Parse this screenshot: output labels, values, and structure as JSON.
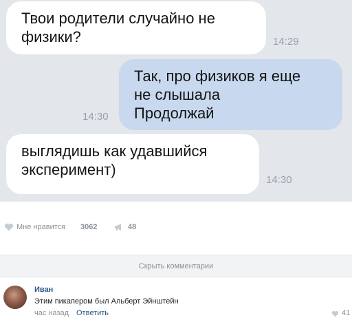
{
  "chat": {
    "messages": [
      {
        "side": "in",
        "text": "Твои родители случайно не\nфизики?",
        "time": "14:29"
      },
      {
        "side": "out",
        "text": "Так, про физиков я еще\nне слышала\nПродолжай",
        "time": "14:30"
      },
      {
        "side": "in",
        "text": "выглядишь как удавшийся\nэксперимент)",
        "time": "14:30"
      }
    ]
  },
  "post": {
    "like_label": "Мне нравится",
    "like_count": "3062",
    "share_count": "48",
    "hide_comments_label": "Скрыть комментарии"
  },
  "comment": {
    "author": "Иван",
    "text": "Этим пикапером был Альберт Эйнштейн",
    "time": "час назад",
    "reply_label": "Ответить",
    "like_count": "41"
  },
  "colors": {
    "chat_background": "#e3e6ea",
    "incoming_bubble": "#ffffff",
    "outgoing_bubble": "#c8d8ee",
    "link": "#2a5885",
    "muted": "#8a9096"
  }
}
